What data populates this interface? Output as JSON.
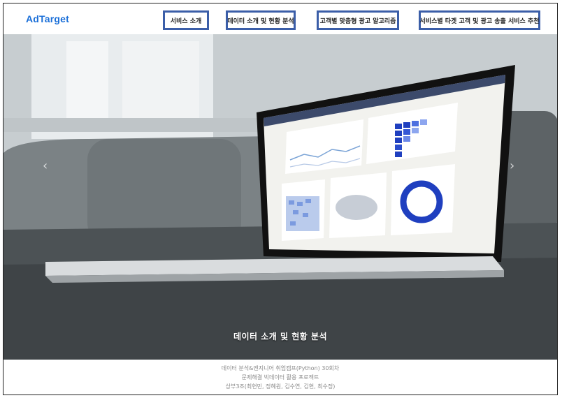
{
  "brand": "AdTarget",
  "nav": [
    "서비스 소개",
    "데이터 소개 및 현황 분석",
    "고객별 맞춤형 광고 알고리즘",
    "서비스별 타겟 고객 및 광고 송출 서비스 추천"
  ],
  "hero": {
    "caption": "데이터 소개 및 현황 분석",
    "prev_icon": "chevron-left-icon",
    "next_icon": "chevron-right-icon"
  },
  "footer": {
    "line1": "데이터 분석&엔지니어 취업캠프(Python) 30회차",
    "line2": "문제해결 빅데이터 활용 프로젝트",
    "line3": "상부3조(최현민, 정혜원, 김수연, 김현, 최수정)"
  },
  "colors": {
    "brand": "#1a6fd8",
    "nav_border": "#3b5ea8"
  }
}
